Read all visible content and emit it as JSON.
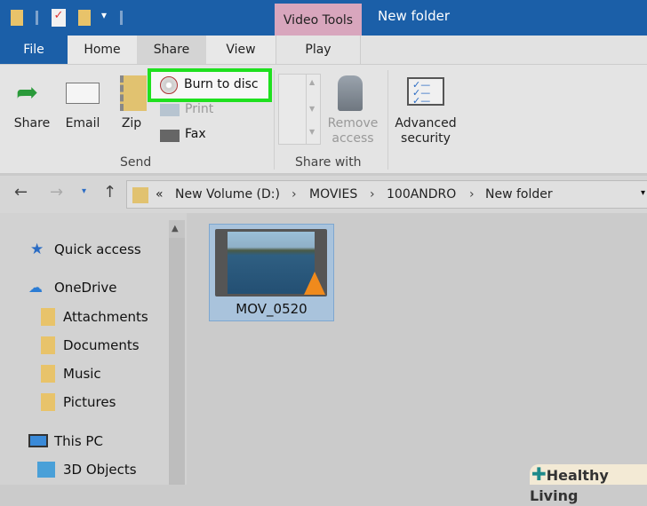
{
  "title_bar": {
    "context_tab": "Video Tools",
    "window_title": "New folder"
  },
  "tabs": [
    "File",
    "Home",
    "Share",
    "View",
    "Play"
  ],
  "ribbon": {
    "share": "Share",
    "email": "Email",
    "zip": "Zip",
    "burn": "Burn to disc",
    "print": "Print",
    "fax": "Fax",
    "group_send": "Send",
    "remove_access": [
      "Remove",
      "access"
    ],
    "group_share_with": "Share with",
    "advanced_security": [
      "Advanced",
      "security"
    ]
  },
  "address": {
    "prefix": "«",
    "crumbs": [
      "New Volume (D:)",
      "MOVIES",
      "100ANDRO",
      "New folder"
    ]
  },
  "nav": {
    "quick_access": "Quick access",
    "onedrive": "OneDrive",
    "folders": [
      "Attachments",
      "Documents",
      "Music",
      "Pictures"
    ],
    "this_pc": "This PC",
    "objects": "3D Objects"
  },
  "files": [
    {
      "name": "MOV_0520"
    }
  ],
  "watermark": "Healthy Living"
}
